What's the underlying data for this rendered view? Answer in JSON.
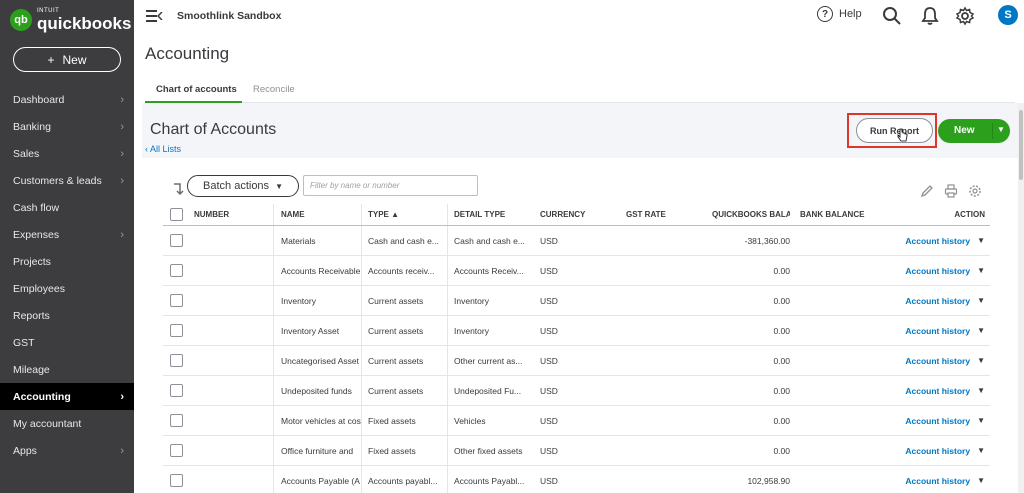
{
  "app": {
    "logo_sub": "INTUIT",
    "logo_word": "quickbooks",
    "logo_mark": "qb",
    "company": "Smoothlink Sandbox",
    "help_label": "Help",
    "help_glyph": "?",
    "avatar_initial": "S"
  },
  "sidebar": {
    "new_label": "New",
    "new_plus": "+",
    "items": [
      {
        "label": "Dashboard",
        "chevron": "›"
      },
      {
        "label": "Banking",
        "chevron": "›"
      },
      {
        "label": "Sales",
        "chevron": "›"
      },
      {
        "label": "Customers & leads",
        "chevron": "›"
      },
      {
        "label": "Cash flow",
        "chevron": ""
      },
      {
        "label": "Expenses",
        "chevron": "›"
      },
      {
        "label": "Projects",
        "chevron": ""
      },
      {
        "label": "Employees",
        "chevron": ""
      },
      {
        "label": "Reports",
        "chevron": ""
      },
      {
        "label": "GST",
        "chevron": ""
      },
      {
        "label": "Mileage",
        "chevron": ""
      },
      {
        "label": "Accounting",
        "chevron": "›",
        "active": true
      },
      {
        "label": "My accountant",
        "chevron": ""
      },
      {
        "label": "Apps",
        "chevron": "›"
      }
    ]
  },
  "page": {
    "title": "Accounting",
    "tabs": [
      {
        "label": "Chart of accounts"
      },
      {
        "label": "Reconcile"
      }
    ],
    "section_title": "Chart of Accounts",
    "all_lists": "‹ All Lists",
    "run_report": "Run Report",
    "new_label": "New",
    "batch_actions": "Batch actions",
    "batch_caret": "▼",
    "filter_placeholder": "Filter by name or number"
  },
  "table": {
    "headers": {
      "number": "NUMBER",
      "name": "NAME",
      "type": "TYPE ▲",
      "detail": "DETAIL TYPE",
      "currency": "CURRENCY",
      "gst": "GST RATE",
      "qb_balance": "QUICKBOOKS BALA",
      "bank_balance": "BANK BALANCE",
      "action": "ACTION"
    },
    "rows": [
      {
        "number": "",
        "name": "Materials",
        "type": "Cash and cash e...",
        "detail": "Cash and cash e...",
        "currency": "USD",
        "gst": "",
        "qb_balance": "-381,360.00",
        "bank_balance": "",
        "action": "Account history"
      },
      {
        "number": "",
        "name": "Accounts Receivable",
        "type": "Accounts receiv...",
        "detail": "Accounts Receiv...",
        "currency": "USD",
        "gst": "",
        "qb_balance": "0.00",
        "bank_balance": "",
        "action": "Account history"
      },
      {
        "number": "",
        "name": "Inventory",
        "type": "Current assets",
        "detail": "Inventory",
        "currency": "USD",
        "gst": "",
        "qb_balance": "0.00",
        "bank_balance": "",
        "action": "Account history"
      },
      {
        "number": "",
        "name": "Inventory Asset",
        "type": "Current assets",
        "detail": "Inventory",
        "currency": "USD",
        "gst": "",
        "qb_balance": "0.00",
        "bank_balance": "",
        "action": "Account history"
      },
      {
        "number": "",
        "name": "Uncategorised Asset",
        "type": "Current assets",
        "detail": "Other current as...",
        "currency": "USD",
        "gst": "",
        "qb_balance": "0.00",
        "bank_balance": "",
        "action": "Account history"
      },
      {
        "number": "",
        "name": "Undeposited funds",
        "type": "Current assets",
        "detail": "Undeposited Fu...",
        "currency": "USD",
        "gst": "",
        "qb_balance": "0.00",
        "bank_balance": "",
        "action": "Account history"
      },
      {
        "number": "",
        "name": "Motor vehicles at cost",
        "type": "Fixed assets",
        "detail": "Vehicles",
        "currency": "USD",
        "gst": "",
        "qb_balance": "0.00",
        "bank_balance": "",
        "action": "Account history"
      },
      {
        "number": "",
        "name": "Office furniture and",
        "type": "Fixed assets",
        "detail": "Other fixed assets",
        "currency": "USD",
        "gst": "",
        "qb_balance": "0.00",
        "bank_balance": "",
        "action": "Account history"
      },
      {
        "number": "",
        "name": "Accounts Payable (A",
        "type": "Accounts payabl...",
        "detail": "Accounts Payabl...",
        "currency": "USD",
        "gst": "",
        "qb_balance": "102,958.90",
        "bank_balance": "",
        "action": "Account history"
      }
    ]
  },
  "colors": {
    "sidebar_bg": "#3d3d40",
    "brand_green": "#2ca01c",
    "link_blue": "#0077c5",
    "highlight_red": "#e0352b"
  },
  "icons": [
    "menu-collapse-icon",
    "help-icon",
    "search-icon",
    "bell-icon",
    "gear-icon",
    "sort-icon",
    "pencil-icon",
    "print-icon",
    "settings-icon",
    "pointer-cursor-icon"
  ]
}
